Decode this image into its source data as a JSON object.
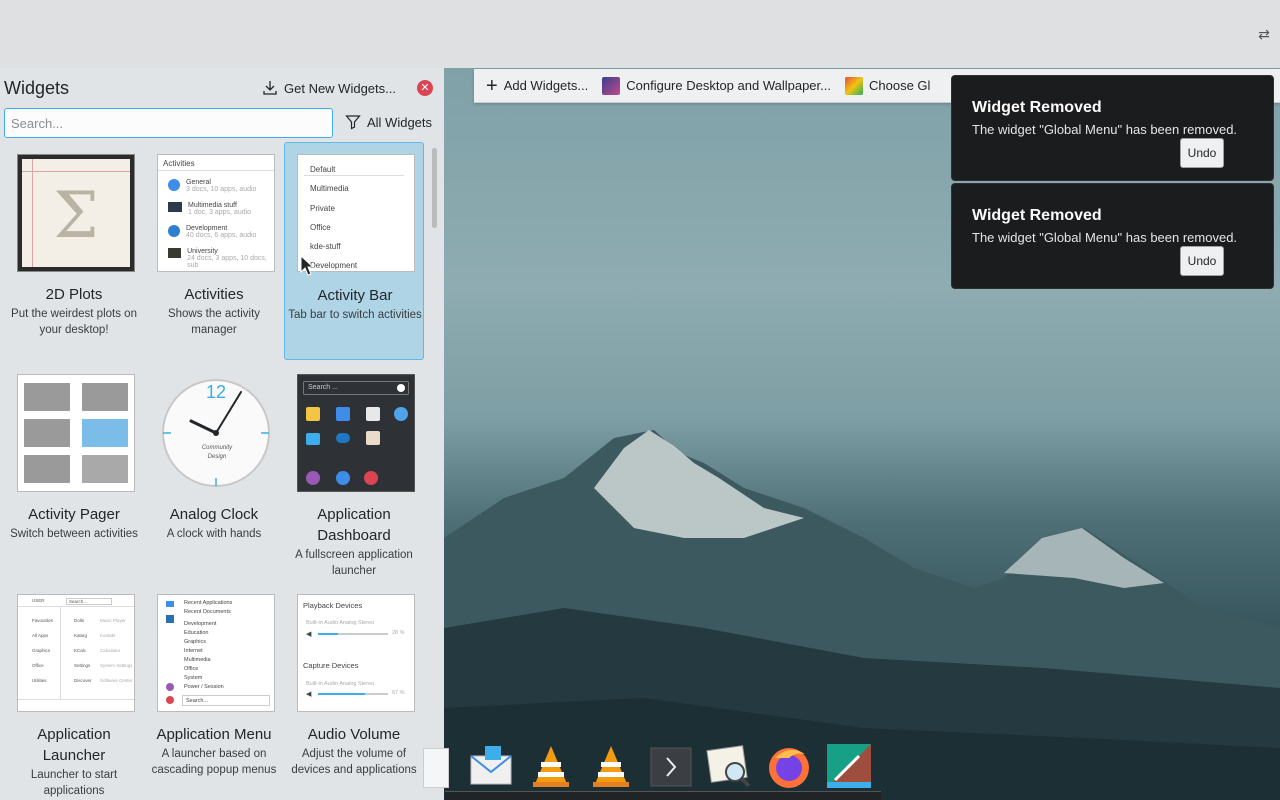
{
  "colors": {
    "accent": "#3daee9",
    "close": "#da4453",
    "notification_bg": "#1b1c1e"
  },
  "desktop_toolbar": {
    "add_widgets": "Add Widgets...",
    "configure_desktop": "Configure Desktop and Wallpaper...",
    "choose_global": "Choose Gl",
    "add_icon": "plus-icon",
    "configure_icon": "wallpaper-icon",
    "choose_icon": "theme-icon"
  },
  "sidebar": {
    "title": "Widgets",
    "get_new_label": "Get New Widgets...",
    "search_placeholder": "Search...",
    "filter_label": "All Widgets",
    "widgets": [
      {
        "name": "2D Plots",
        "description": "Put the weirdest plots on your desktop!"
      },
      {
        "name": "Activities",
        "description": "Shows the activity manager"
      },
      {
        "name": "Activity Bar",
        "description": "Tab bar to switch activities",
        "selected": true
      },
      {
        "name": "Activity Pager",
        "description": "Switch between activities"
      },
      {
        "name": "Analog Clock",
        "description": "A clock with hands"
      },
      {
        "name": "Application Dashboard",
        "description": "A fullscreen application launcher"
      },
      {
        "name": "Application Launcher",
        "description": "Launcher to start applications"
      },
      {
        "name": "Application Menu",
        "description": "A launcher based on cascading popup menus"
      },
      {
        "name": "Audio Volume",
        "description": "Adjust the volume of devices and applications"
      }
    ],
    "thumbs": {
      "activities": {
        "header": "Activities",
        "items": [
          {
            "name": "General",
            "meta": "3 docs, 10 apps, audio"
          },
          {
            "name": "Multimedia stuff",
            "meta": "1 doc, 3 apps, audio"
          },
          {
            "name": "Development",
            "meta": "40 docs, 6 apps, audio"
          },
          {
            "name": "University",
            "meta": "24 docs, 3 apps, 10 docs, sub"
          }
        ]
      },
      "activity_bar": [
        "Default",
        "Multimedia",
        "Private",
        "Office",
        "kde-stuff",
        "Development"
      ],
      "clock": {
        "numeral": "12",
        "brand": "Community Design"
      },
      "dashboard_search": "Search ...",
      "launcher": {
        "user": "USER",
        "search": "Search...",
        "rows": [
          {
            "a": "Favourites",
            "b": "Dolls",
            "c": "Music Player"
          },
          {
            "a": "All Apps",
            "b": "Kalarg",
            "c": "Kontakt"
          },
          {
            "a": "Graphics",
            "b": "KCalc",
            "c": "Calculator"
          },
          {
            "a": "Office",
            "b": "Settings",
            "c": "System Settings"
          },
          {
            "a": "Utilities",
            "b": "Discover",
            "c": "Software Center"
          }
        ]
      },
      "app_menu": {
        "items": [
          "Recent Applications",
          "Recent Documents",
          "Development",
          "Education",
          "Graphics",
          "Internet",
          "Multimedia",
          "Office",
          "System",
          "Power / Session"
        ],
        "search": "Search..."
      },
      "audio": {
        "playback_title": "Playback Devices",
        "playback_device": "Built-in Audio Analog Stereo",
        "playback_pct": "28 %",
        "capture_title": "Capture Devices",
        "capture_device": "Built-in Audio Analog Stereo",
        "capture_pct": "67 %",
        "playback_level": 0.28,
        "capture_level": 0.67
      }
    }
  },
  "notifications": [
    {
      "title": "Widget Removed",
      "body": "The widget \"Global Menu\" has been removed.",
      "action": "Undo"
    },
    {
      "title": "Widget Removed",
      "body": "The widget \"Global Menu\" has been removed.",
      "action": "Undo"
    }
  ],
  "dock": {
    "items": [
      "text-editor-icon",
      "mail-icon",
      "vlc-icon",
      "vlc-icon",
      "terminal-icon",
      "image-viewer-icon",
      "firefox-icon",
      "kdevelop-icon"
    ]
  }
}
